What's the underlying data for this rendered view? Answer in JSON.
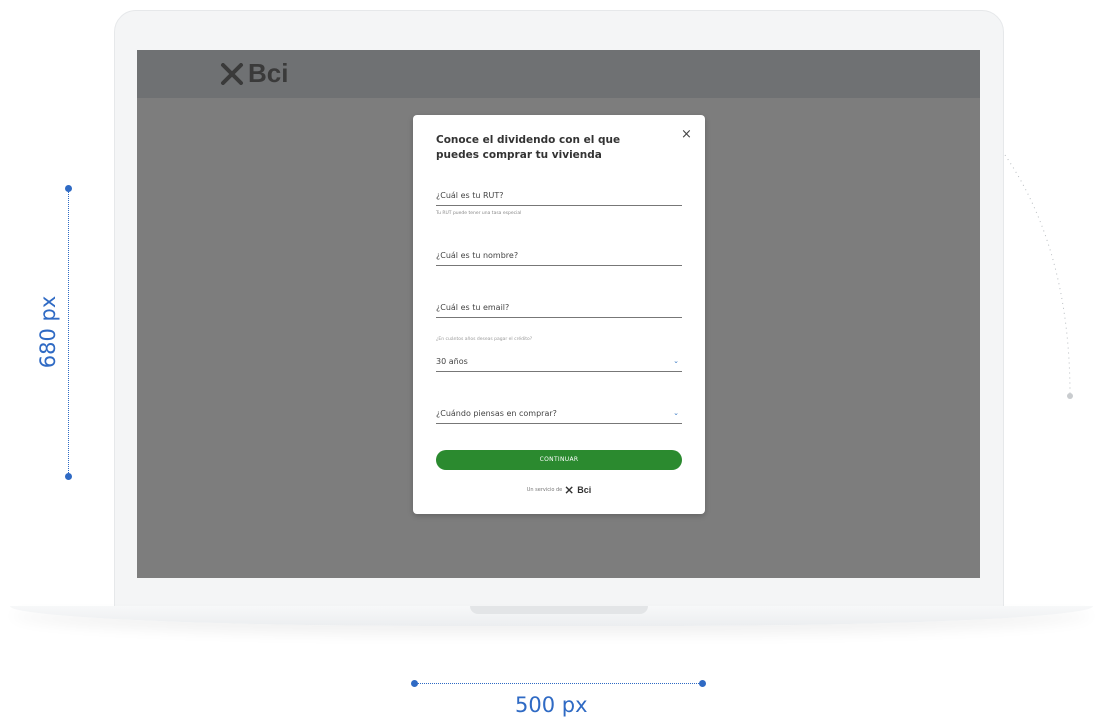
{
  "brand": {
    "name": "Bci"
  },
  "modal": {
    "title": "Conoce el dividendo con el que puedes comprar tu vivienda",
    "close_icon": "×",
    "fields": [
      {
        "label": "¿Cuál es tu RUT?"
      },
      {
        "label": "¿Cuál es tu nombre?"
      },
      {
        "label": "¿Cuál es tu email?"
      },
      {
        "label": "30 años"
      },
      {
        "label": "¿Cuándo piensas en comprar?"
      }
    ],
    "rut_helper": "Tu RUT puede tener una tasa especial",
    "years_caption": "¿En cuántos años deseas pagar el crédito?",
    "continue_label": "CONTINUAR",
    "footer_text": "Un servicio de",
    "footer_brand": "Bci"
  },
  "dimensions": {
    "height_label": "680 px",
    "width_label": "500 px"
  },
  "colors": {
    "accent": "#2b8a2f",
    "annotation": "#2f6ac4",
    "overlay": "#7d7d7d"
  }
}
